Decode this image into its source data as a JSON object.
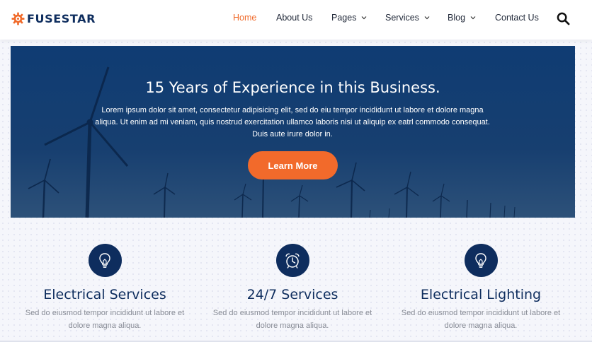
{
  "brand": {
    "name": "FUSESTAR",
    "accent": "#f06a2a",
    "navy": "#0e2d5e"
  },
  "nav": {
    "items": [
      {
        "label": "Home",
        "active": true,
        "dropdown": false
      },
      {
        "label": "About Us",
        "active": false,
        "dropdown": false
      },
      {
        "label": "Pages",
        "active": false,
        "dropdown": true
      },
      {
        "label": "Services",
        "active": false,
        "dropdown": true
      },
      {
        "label": "Blog",
        "active": false,
        "dropdown": true
      },
      {
        "label": "Contact Us",
        "active": false,
        "dropdown": false
      }
    ],
    "search_icon": "search-icon"
  },
  "hero": {
    "title": "15 Years of Experience in this Business.",
    "text": "Lorem ipsum dolor sit amet, consectetur adipisicing elit, sed do eiu tempor incididunt ut labore et dolore magna aliqua. Ut enim ad mi veniam, quis nostrud exercitation ullamco laboris nisi ut aliquip ex eatrl commodo consequat. Duis aute irure dolor in.",
    "button": "Learn More"
  },
  "services": [
    {
      "icon": "lightbulb-icon",
      "title": "Electrical Services",
      "desc": "Sed do eiusmod tempor incididunt ut labore et dolore magna aliqua."
    },
    {
      "icon": "alarm-clock-icon",
      "title": "24/7 Services",
      "desc": "Sed do eiusmod tempor incididunt ut labore et dolore magna aliqua."
    },
    {
      "icon": "lightbulb-icon",
      "title": "Electrical Lighting",
      "desc": "Sed do eiusmod tempor incididunt ut labore et dolore magna aliqua."
    }
  ]
}
